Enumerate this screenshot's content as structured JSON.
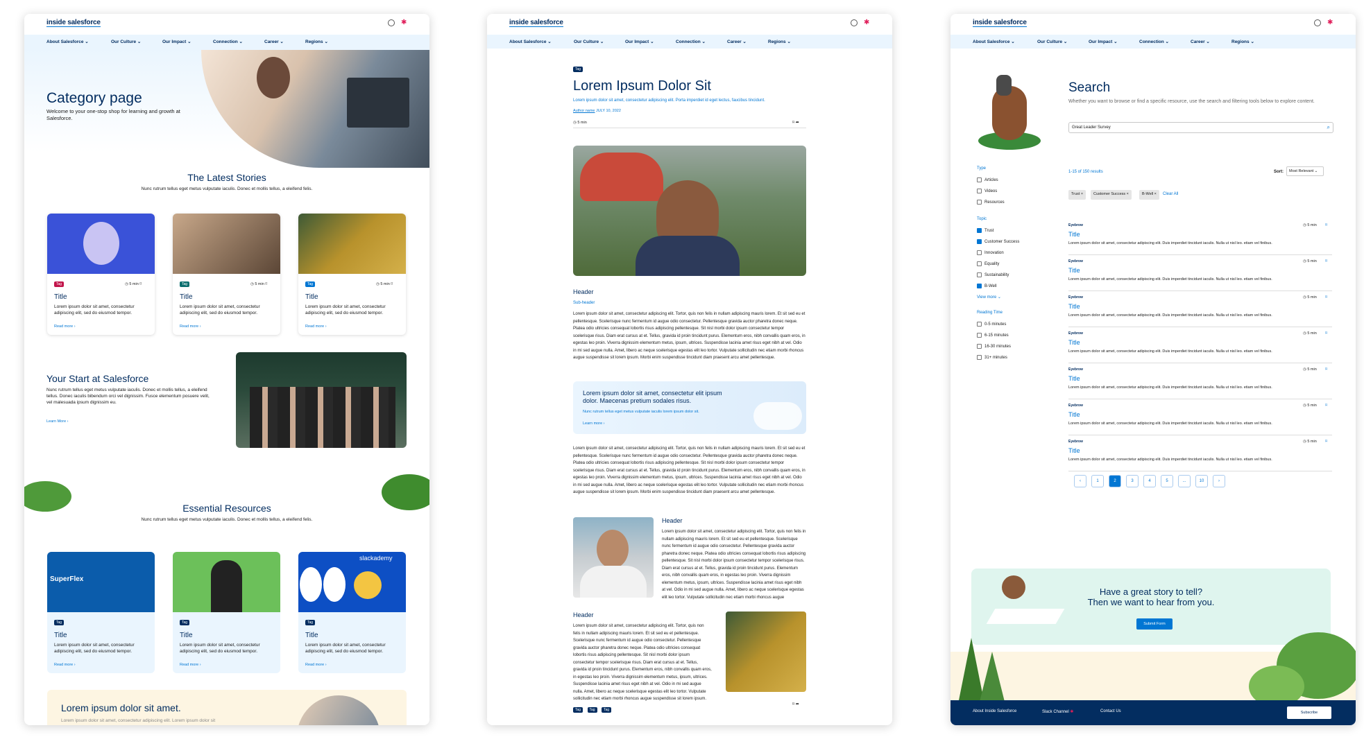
{
  "brand": "inside salesforce",
  "nav": [
    "About Salesforce",
    "Our Culture",
    "Our Impact",
    "Connection",
    "Career",
    "Regions"
  ],
  "category": {
    "title": "Category page",
    "intro": "Welcome to your one-stop shop for learning and growth at Salesforce.",
    "latest_title": "The Latest Stories",
    "latest_sub": "Nunc rutrum tellus eget metus vulputate iaculis. Donec et mollis tellus, a eleifend felis.",
    "cards": [
      {
        "tag": "Tag",
        "time": "5 min",
        "title": "Title",
        "body": "Lorem ipsum dolor sit amet, consectetur adipiscing elit, sed do eiusmod tempor.",
        "link": "Read more"
      },
      {
        "tag": "Tag",
        "time": "5 min",
        "title": "Title",
        "body": "Lorem ipsum dolor sit amet, consectetur adipiscing elit, sed do eiusmod tempor.",
        "link": "Read more"
      },
      {
        "tag": "Tag",
        "time": "5 min",
        "title": "Title",
        "body": "Lorem ipsum dolor sit amet, consectetur adipiscing elit, sed do eiusmod tempor.",
        "link": "Read more"
      }
    ],
    "start_title": "Your Start at Salesforce",
    "start_body": "Nunc rutrum tellus eget metus vulputate iaculis. Donec et mollis tellus, a eleifend tellus. Donec iaculis bibendum orci vel dignissim. Fusce elementum posuere velit, vel malesuada ipsum dignissim eu.",
    "start_link": "Learn More",
    "resources_title": "Essential Resources",
    "resources_sub": "Nunc rutrum tellus eget metus vulputate iaculis. Donec et mollis tellus, a eleifend felis.",
    "resources": [
      {
        "tag": "Tag",
        "title": "Title",
        "body": "Lorem ipsum dolor sit amet, consectetur adipiscing elit, sed do eiusmod tempor.",
        "link": "Read more",
        "img_text": "SuperFlex"
      },
      {
        "tag": "Tag",
        "title": "Title",
        "body": "Lorem ipsum dolor sit amet, consectetur adipiscing elit, sed do eiusmod tempor.",
        "link": "Read more",
        "img_text": ""
      },
      {
        "tag": "Tag",
        "title": "Title",
        "body": "Lorem ipsum dolor sit amet, consectetur adipiscing elit, sed do eiusmod tempor.",
        "link": "Read more",
        "img_text": "slackademy"
      }
    ],
    "promo_title": "Lorem ipsum dolor sit amet.",
    "promo_body": "Lorem ipsum dolor sit amet, consectetur adipiscing elit. Lorem ipsum dolor sit"
  },
  "article": {
    "tag": "Tag",
    "title": "Lorem Ipsum Dolor Sit",
    "subtitle": "Lorem ipsum dolor sit amet, consectetur adipiscing elit. Porta imperdiet id eget lectus, faucibus tincidunt.",
    "author": "Author name",
    "date": "JULY 10, 2022",
    "time": "5 min",
    "header1": "Header",
    "subheader": "Sub-header",
    "body": "Lorem ipsum dolor sit amet, consectetur adipiscing elit. Tortor, quis non felis in nullam adipiscing mauris lorem. Et sit sed eu et pellentesque. Scelerisque nunc fermentum id augue odio consectetur. Pellentesque gravida auctor pharetra donec neque. Platea odio ultricies consequat lobortis risus adipiscing pellentesque. Sit nisl morbi dolor ipsum consectetur tempor scelerisque risus. Diam erat cursus at et. Tellus, gravida id proin tincidunt purus. Elementum eros, nibh convallis quam eros, in egestas leo proin. Viverra dignissim elementum metus, ipsum, ultrices. Suspendisse lacinia amet risus eget nibh at vel. Odio in mi sed augue nulla. Amet, libero ac neque scelerisque egestas elit leo tortor. Vulputate sollicitudin nec etiam morbi rhoncus augue suspendisse sit lorem ipsum. Morbi enim suspendisse tincidunt diam praesent arcu amet pellentesque.",
    "callout_title": "Lorem ipsum dolor sit amet, consectetur elit ipsum dolor. Maecenas pretium sodales risus.",
    "callout_body": "Nunc rutrum tellus eget metus vulputate iaculis lorem ipsum dolor sit.",
    "callout_link": "Learn more",
    "header2": "Header",
    "header3": "Header",
    "tags": [
      "Tag",
      "Tag",
      "Tag"
    ]
  },
  "search": {
    "title": "Search",
    "desc": "Whether you want to browse or find a specific resource, use the search and filtering tools below to explore content.",
    "query": "Great Leader Survey",
    "type_label": "Type",
    "types": [
      {
        "label": "Articles",
        "checked": false
      },
      {
        "label": "Videos",
        "checked": false
      },
      {
        "label": "Resources",
        "checked": false
      }
    ],
    "topic_label": "Topic",
    "topics": [
      {
        "label": "Trust",
        "checked": true
      },
      {
        "label": "Customer Success",
        "checked": true
      },
      {
        "label": "Innovation",
        "checked": false
      },
      {
        "label": "Equality",
        "checked": false
      },
      {
        "label": "Sustainability",
        "checked": false
      },
      {
        "label": "B-Well",
        "checked": true
      }
    ],
    "view_more": "View more",
    "time_label": "Reading Time",
    "times": [
      {
        "label": "0-5 minutes",
        "checked": false
      },
      {
        "label": "6-15 minutes",
        "checked": false
      },
      {
        "label": "16-30 minutes",
        "checked": false
      },
      {
        "label": "31+ minutes",
        "checked": false
      }
    ],
    "count": "1-15 of 150 results",
    "sort_label": "Sort:",
    "sort_value": "Most Relevant",
    "chips": [
      "Trust",
      "Customer Success",
      "B-Well"
    ],
    "clear": "Clear All",
    "results": [
      {
        "eyebrow": "Eyebrow",
        "time": "5 min",
        "title": "Title",
        "body": "Lorem ipsum dolor sit amet, consectetur adipiscing elit. Duis imperdiet tincidunt iaculis. Nulla ut nisl leo. etiam vel finibus."
      },
      {
        "eyebrow": "Eyebrow",
        "time": "5 min",
        "title": "Title",
        "body": "Lorem ipsum dolor sit amet, consectetur adipiscing elit. Duis imperdiet tincidunt iaculis. Nulla ut nisl leo. etiam vel finibus."
      },
      {
        "eyebrow": "Eyebrow",
        "time": "5 min",
        "title": "Title",
        "body": "Lorem ipsum dolor sit amet, consectetur adipiscing elit. Duis imperdiet tincidunt iaculis. Nulla ut nisl leo. etiam vel finibus."
      },
      {
        "eyebrow": "Eyebrow",
        "time": "5 min",
        "title": "Title",
        "body": "Lorem ipsum dolor sit amet, consectetur adipiscing elit. Duis imperdiet tincidunt iaculis. Nulla ut nisl leo. etiam vel finibus."
      },
      {
        "eyebrow": "Eyebrow",
        "time": "5 min",
        "title": "Title",
        "body": "Lorem ipsum dolor sit amet, consectetur adipiscing elit. Duis imperdiet tincidunt iaculis. Nulla ut nisl leo. etiam vel finibus."
      },
      {
        "eyebrow": "Eyebrow",
        "time": "5 min",
        "title": "Title",
        "body": "Lorem ipsum dolor sit amet, consectetur adipiscing elit. Duis imperdiet tincidunt iaculis. Nulla ut nisl leo. etiam vel finibus."
      },
      {
        "eyebrow": "Eyebrow",
        "time": "5 min",
        "title": "Title",
        "body": "Lorem ipsum dolor sit amet, consectetur adipiscing elit. Duis imperdiet tincidunt iaculis. Nulla ut nisl leo. etiam vel finibus."
      }
    ],
    "pages": [
      "‹",
      "1",
      "2",
      "3",
      "4",
      "5",
      "...",
      "10",
      "›"
    ],
    "current_page": "2",
    "story_line1": "Have a great story to tell?",
    "story_line2": "Then we want to hear from you.",
    "submit": "Submit Form",
    "footer": [
      "About Inside Salesforce",
      "Slack Channel",
      "Contact Us"
    ],
    "subscribe": "Subscribe"
  },
  "colors": {
    "navy": "#032d60",
    "blue": "#0176d3",
    "light": "#eaf5fe",
    "mint": "#dff5ee",
    "sand": "#fdf5e2"
  }
}
